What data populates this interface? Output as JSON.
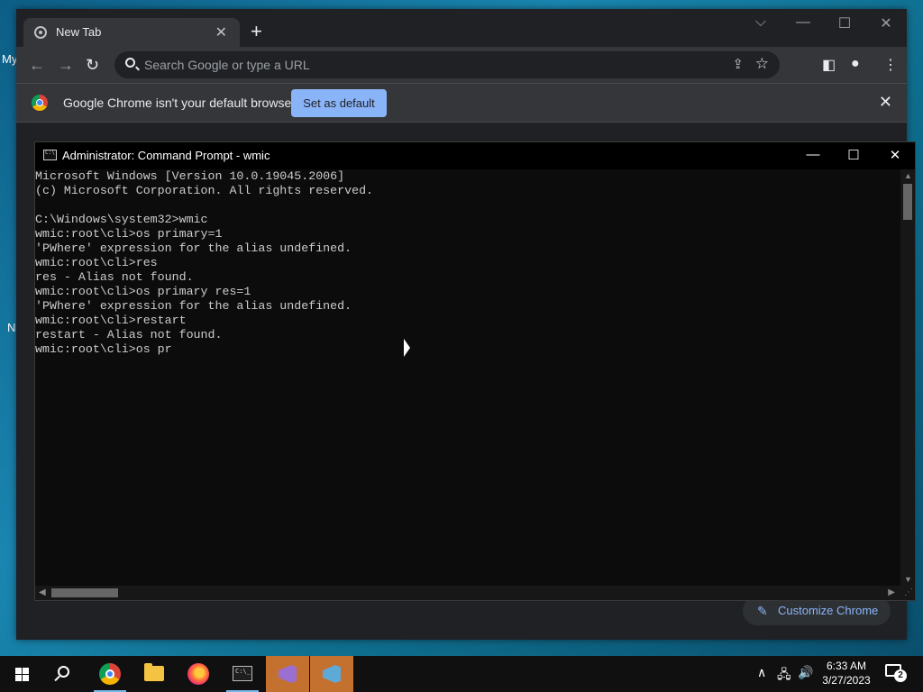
{
  "desktop": {
    "frag1": "My",
    "frag2": "N"
  },
  "chrome": {
    "tab": {
      "title": "New Tab",
      "close_glyph": "✕"
    },
    "new_tab_glyph": "+",
    "window_controls": {
      "dropdown": "⌵",
      "minimize": "—",
      "maximize": "☐",
      "close": "✕"
    },
    "nav": {
      "back": "←",
      "forward": "→",
      "reload": "↻"
    },
    "omnibox": {
      "placeholder": "Search Google or type a URL",
      "share": "⇪",
      "star": "☆"
    },
    "toolbar_icons": {
      "sidepanel": "◧",
      "profile": "●",
      "menu": "⋮"
    },
    "infobar": {
      "message": "Google Chrome isn't your default browser",
      "button": "Set as default",
      "close": "✕"
    },
    "customize": {
      "label": "Customize Chrome",
      "icon": "✎"
    }
  },
  "cmd": {
    "title": "Administrator:  Command Prompt - wmic",
    "controls": {
      "minimize": "—",
      "maximize": "☐",
      "close": "✕"
    },
    "lines": [
      "Microsoft Windows [Version 10.0.19045.2006]",
      "(c) Microsoft Corporation. All rights reserved.",
      "",
      "C:\\Windows\\system32>wmic",
      "wmic:root\\cli>os primary=1",
      "'PWhere' expression for the alias undefined.",
      "wmic:root\\cli>res",
      "res - Alias not found.",
      "wmic:root\\cli>os primary res=1",
      "'PWhere' expression for the alias undefined.",
      "wmic:root\\cli>restart",
      "restart - Alias not found.",
      "wmic:root\\cli>os pr"
    ],
    "scroll": {
      "up": "▲",
      "down": "▼",
      "left": "◀",
      "right": "▶",
      "grip": "⋰"
    }
  },
  "taskbar": {
    "apps": [
      {
        "id": "start",
        "icon": "windows-start-icon"
      },
      {
        "id": "search",
        "icon": "search-icon"
      },
      {
        "id": "chrome",
        "icon": "chrome-icon"
      },
      {
        "id": "explorer",
        "icon": "folder-icon"
      },
      {
        "id": "firefox",
        "icon": "firefox-icon"
      },
      {
        "id": "cmd",
        "icon": "terminal-icon",
        "label": "C:\\_"
      },
      {
        "id": "vs1",
        "icon": "visual-studio-icon"
      },
      {
        "id": "vs2",
        "icon": "visual-studio-icon"
      }
    ],
    "tray": {
      "chevron": "∧",
      "network": "🖧",
      "volume": "🔊"
    },
    "time": "6:33 AM",
    "date": "3/27/2023",
    "notifications": "2"
  }
}
